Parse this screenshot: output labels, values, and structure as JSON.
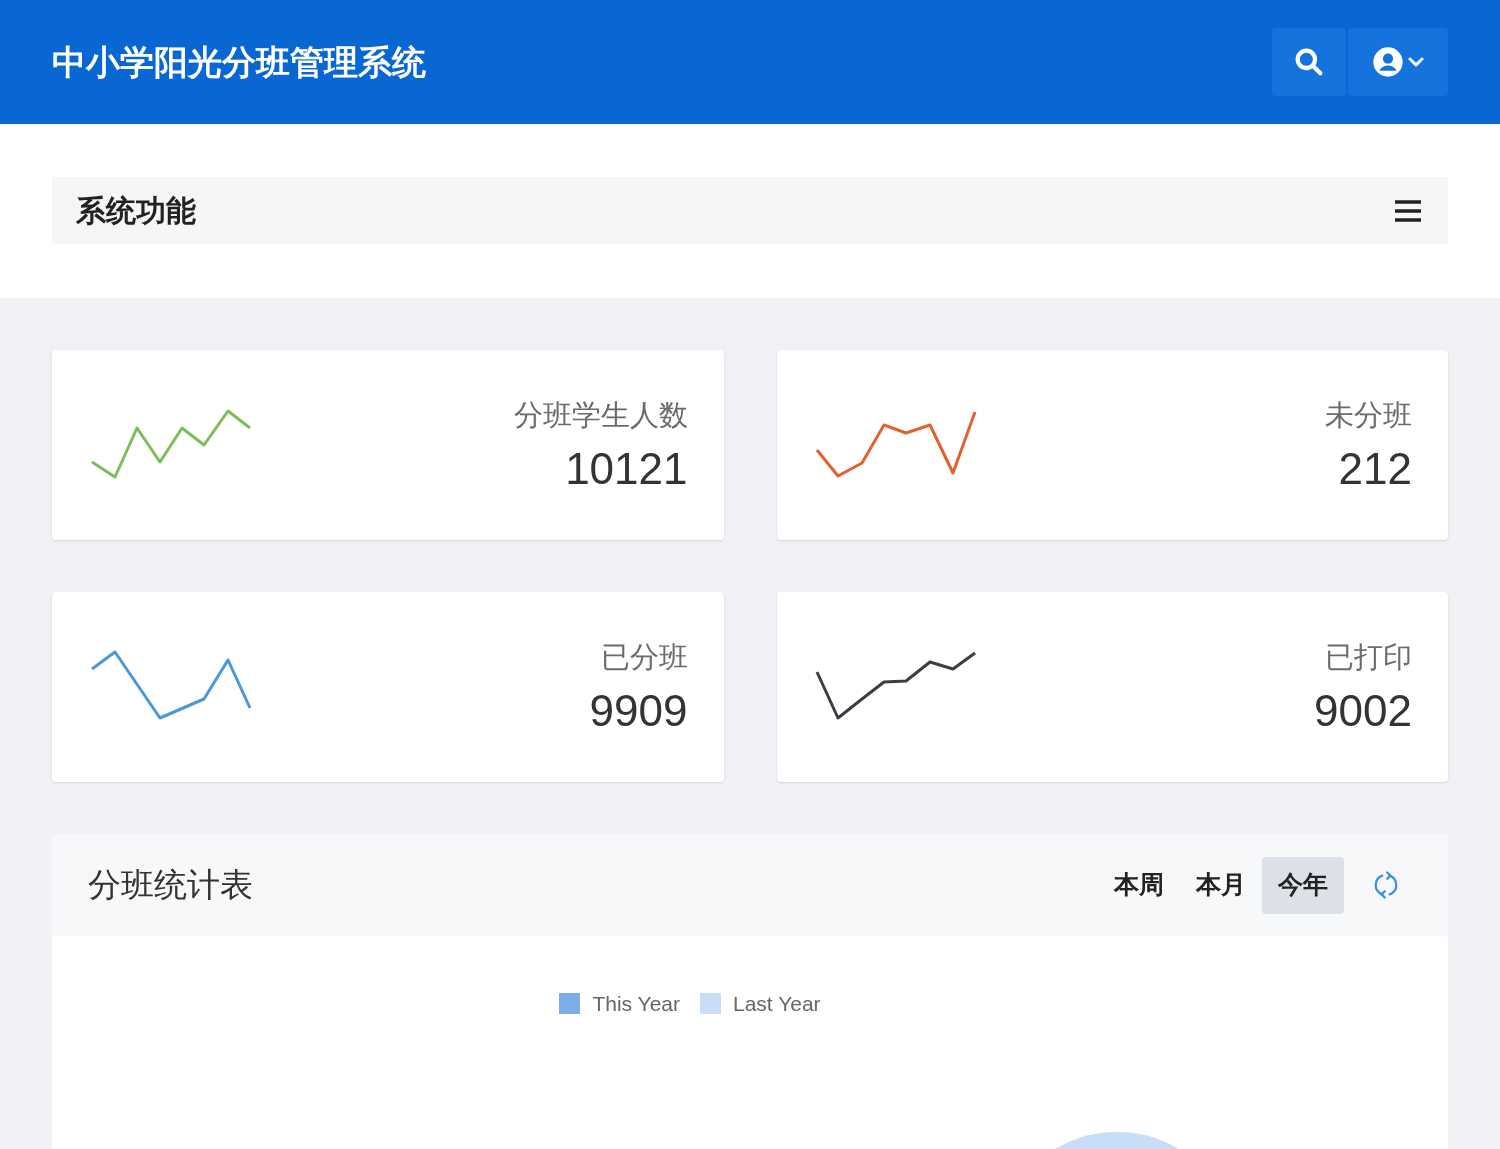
{
  "header": {
    "title": "中小学阳光分班管理系统"
  },
  "nav_bar": {
    "title": "系统功能"
  },
  "stats": [
    {
      "label": "分班学生人数",
      "value": "10121",
      "color": "#7cbf5a"
    },
    {
      "label": "未分班",
      "value": "212",
      "color": "#e0622f"
    },
    {
      "label": "已分班",
      "value": "9909",
      "color": "#4a98d8"
    },
    {
      "label": "已打印",
      "value": "9002",
      "color": "#3a3f45"
    }
  ],
  "chart_panel": {
    "title": "分班统计表",
    "tabs": [
      {
        "label": "本周",
        "selected": false
      },
      {
        "label": "本月",
        "selected": false
      },
      {
        "label": "今年",
        "selected": true
      }
    ],
    "legend": [
      {
        "name": "This Year",
        "color": "#7baee8"
      },
      {
        "name": "Last Year",
        "color": "#c9ddf6"
      }
    ]
  }
}
